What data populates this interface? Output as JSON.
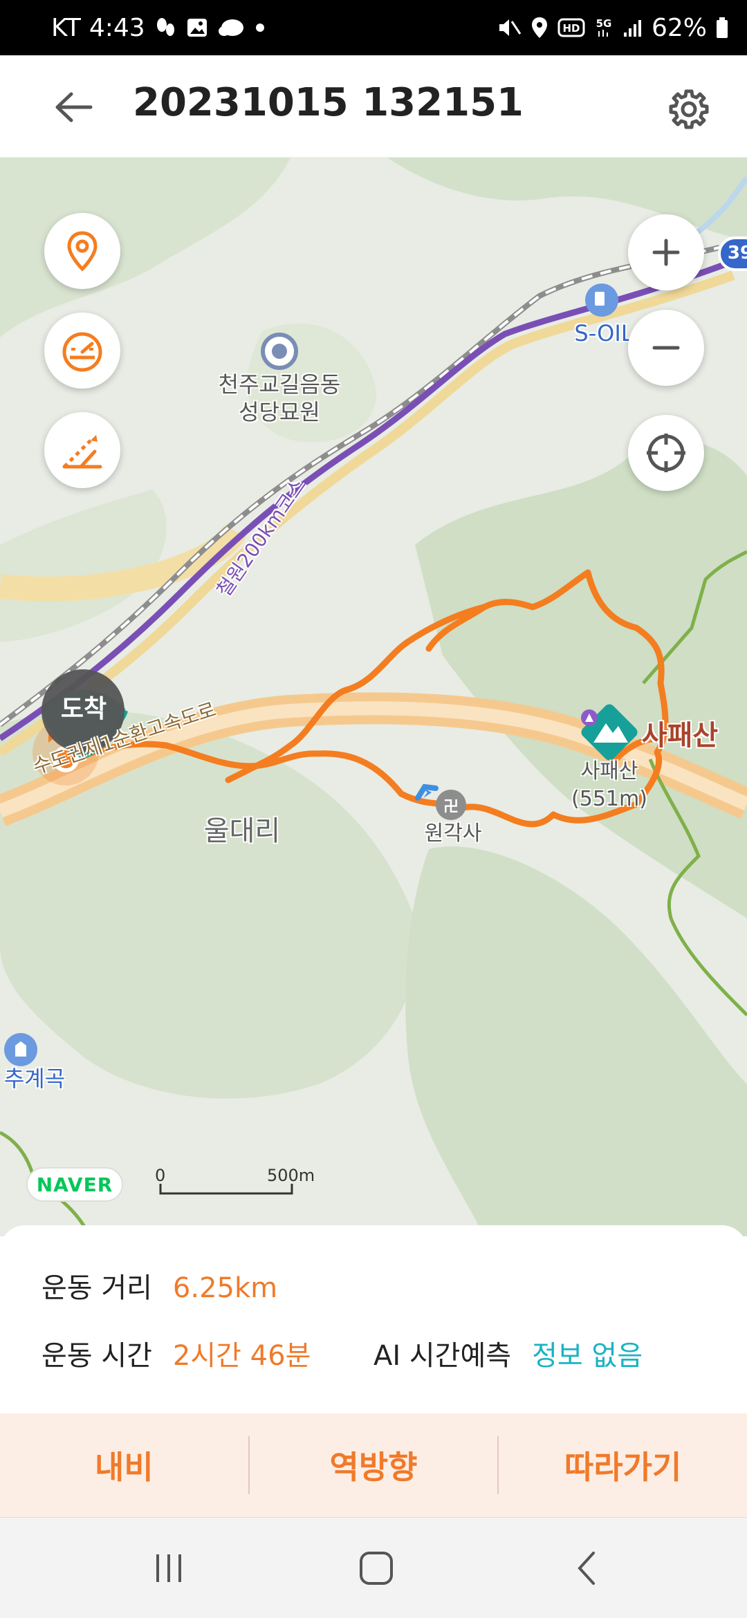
{
  "status_bar": {
    "carrier": "KT",
    "time": "4:43",
    "network": "5G",
    "hd": "HD",
    "battery": "62%"
  },
  "header": {
    "title": "20231015 132151",
    "back_icon": "arrow-left-icon",
    "settings_icon": "gear-icon"
  },
  "map": {
    "buttons": {
      "location_icon": "location-pin-icon",
      "speed_icon": "speedometer-icon",
      "slope_icon": "slope-icon",
      "zoom_in": "+",
      "zoom_out": "−",
      "target_icon": "crosshair-icon"
    },
    "labels": {
      "cemetery": "천주교길음동\n성당묘원",
      "bike_course": "철원200km코스",
      "expressway": "수도권제1순환고속도로",
      "village": "울대리",
      "temple": "원각사",
      "mountain_name": "사패산",
      "mountain_elev": "사패산\n(551m)",
      "gas_station": "S-OIL",
      "valley": "추계곡",
      "arrival": "도착",
      "road_number": "39"
    },
    "naver_logo": "NAVER",
    "scale": {
      "start": "0",
      "end": "500m"
    },
    "colors": {
      "track": "#f47d20",
      "route_purple": "#7a4fb5",
      "expressway": "#f5c98e",
      "trail_green": "#7fb04a"
    }
  },
  "stats": {
    "distance_label": "운동 거리",
    "distance_value": "6.25km",
    "time_label": "운동 시간",
    "time_value": "2시간 46분",
    "ai_label": "AI 시간예측",
    "ai_value": "정보 없음"
  },
  "actions": {
    "navigate": "내비",
    "reverse": "역방향",
    "follow": "따라가기"
  },
  "nav": {
    "recent_icon": "recent-apps-icon",
    "home_icon": "home-icon",
    "back_icon": "back-chevron-icon"
  }
}
